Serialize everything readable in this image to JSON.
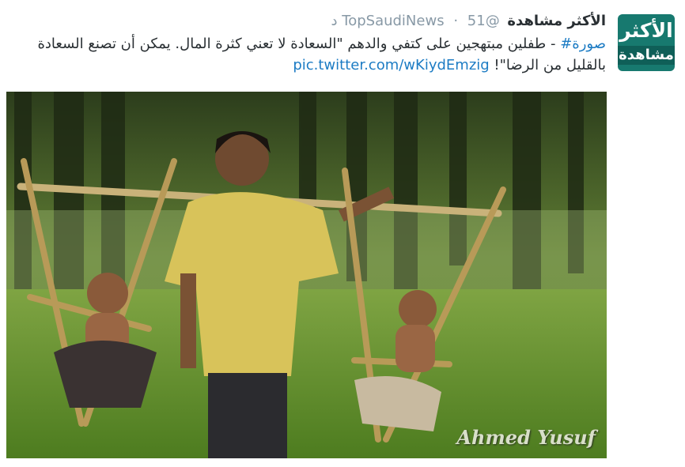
{
  "account": {
    "avatar_line1": "الأكثر",
    "avatar_line2": "مشاهدة",
    "name": "الأكثر مشاهدة",
    "handle": "@TopSaudiNews",
    "separator": "·",
    "time": "51 د"
  },
  "tweet": {
    "hashtag": "صورة#",
    "body": " - طفلين مبتهجين على كتفي والدهم \"السعادة لا تعني كثرة المال. يمكن أن تصنع السعادة بالقليل من الرضا\"! ",
    "link": "pic.twitter.com/wKiydEmzig"
  },
  "photo": {
    "watermark": "Ahmed Yusuf"
  }
}
